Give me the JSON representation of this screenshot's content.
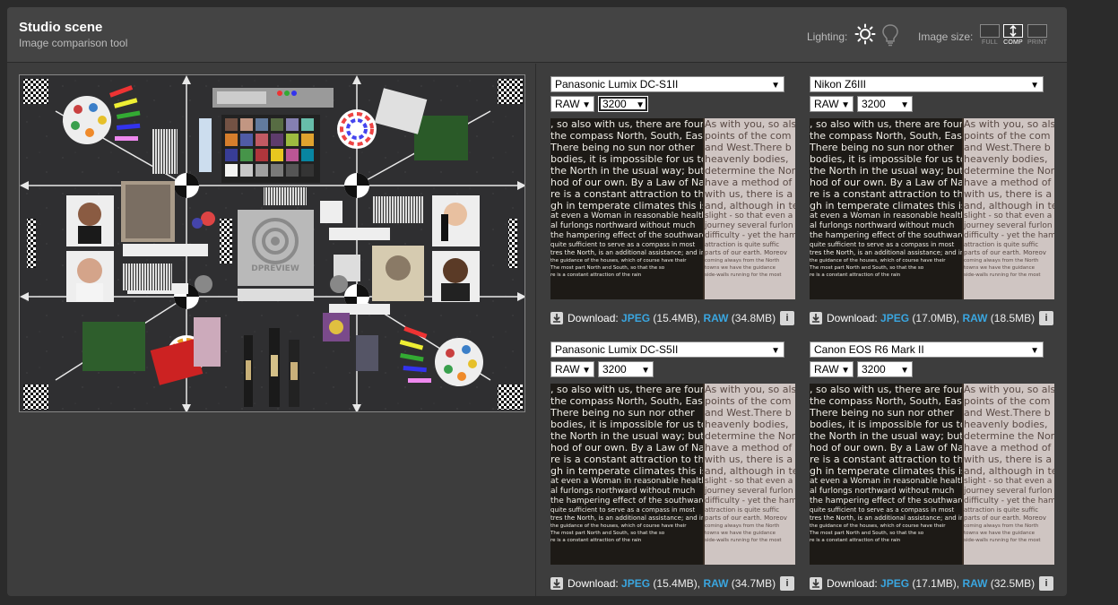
{
  "header": {
    "title": "Studio scene",
    "subtitle": "Image comparison tool",
    "lighting_label": "Lighting:",
    "image_size_label": "Image size:",
    "size_options": [
      "FULL",
      "COMP",
      "PRINT"
    ],
    "selected_size": "COMP"
  },
  "colors": {
    "page_bg": "#2b2b2b",
    "app_bg": "#3d3d3d",
    "header_bg": "#444444",
    "link": "#3aa6e0"
  },
  "scene": {
    "label_brand": "DPREVIEW"
  },
  "crop_text": {
    "dark_lines": [
      ", so also with us, there are four",
      "the compass North, South, East,",
      "There being no sun nor other",
      "bodies, it is impossible for us to",
      "the North in the usual way; but we",
      "hod of our own. By a Law of Nature",
      "re is a constant attraction to the South;",
      "gh in temperate climates this is very",
      "at even a Woman in reasonable health can",
      "al furlongs northward without much",
      "the hampering effect of the southward",
      "quite sufficient to serve as a compass in most",
      "tres the North, is an additional assistance; and in the",
      "the guidance of the houses, which of course have their",
      "The most part North and South, so that the so",
      "re is a constant attraction of the rain"
    ],
    "light_lines": [
      "As with you, so also",
      "points of the com",
      "and West.There b",
      "heavenly bodies,",
      "determine the North",
      "have a method of o",
      "with us, there is a con",
      "and, although in tem",
      "slight - so that even a",
      "journey several furlon",
      "difficulty - yet the ham",
      "attraction is quite suffic",
      "parts of our earth. Moreov",
      "coming always from the North",
      "towns we have the guidance",
      "side-walls running for the most"
    ]
  },
  "panels": [
    {
      "camera": "Panasonic Lumix DC-S1II",
      "format": "RAW",
      "iso": "3200",
      "download_label": "Download:",
      "jpeg_label": "JPEG",
      "jpeg_size": "(15.4MB),",
      "raw_label": "RAW",
      "raw_size": "(34.8MB)"
    },
    {
      "camera": "Nikon Z6III",
      "format": "RAW",
      "iso": "3200",
      "download_label": "Download:",
      "jpeg_label": "JPEG",
      "jpeg_size": "(17.0MB),",
      "raw_label": "RAW",
      "raw_size": "(18.5MB)"
    },
    {
      "camera": "Panasonic Lumix DC-S5II",
      "format": "RAW",
      "iso": "3200",
      "download_label": "Download:",
      "jpeg_label": "JPEG",
      "jpeg_size": "(15.4MB),",
      "raw_label": "RAW",
      "raw_size": "(34.7MB)"
    },
    {
      "camera": "Canon EOS R6 Mark II",
      "format": "RAW",
      "iso": "3200",
      "download_label": "Download:",
      "jpeg_label": "JPEG",
      "jpeg_size": "(17.1MB),",
      "raw_label": "RAW",
      "raw_size": "(32.5MB)"
    }
  ]
}
